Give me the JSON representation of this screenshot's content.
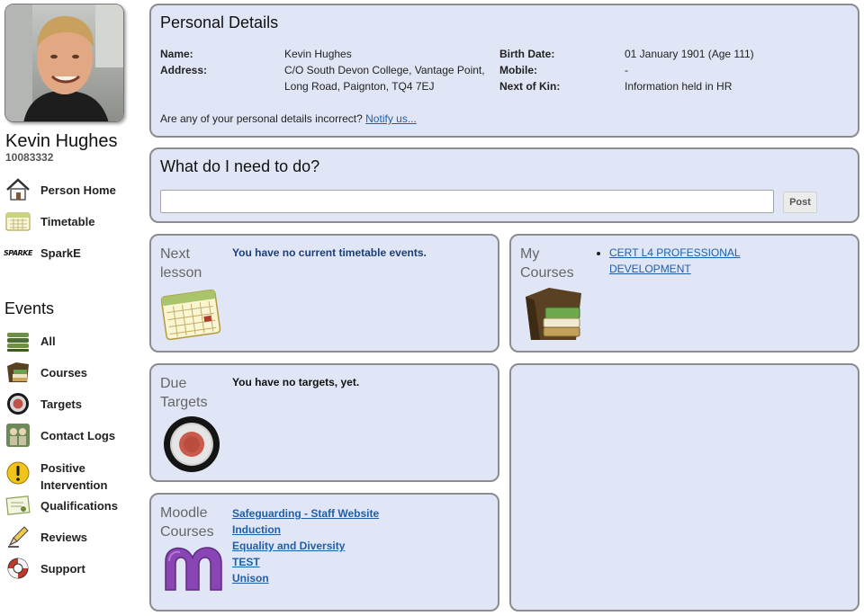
{
  "user": {
    "name": "Kevin Hughes",
    "id": "10083332"
  },
  "nav": {
    "items": [
      {
        "label": "Person Home",
        "icon": "house-icon"
      },
      {
        "label": "Timetable",
        "icon": "calendar-icon"
      },
      {
        "label": "SparkE",
        "icon": "sparke-logo-icon",
        "logo_text": "SPARKE"
      }
    ]
  },
  "events": {
    "heading": "Events",
    "items": [
      {
        "label": "All",
        "icon": "stack-icon"
      },
      {
        "label": "Courses",
        "icon": "folder-books-icon"
      },
      {
        "label": "Targets",
        "icon": "target-icon"
      },
      {
        "label": "Contact Logs",
        "icon": "people-icon"
      },
      {
        "label": "Positive Intervention",
        "icon": "exclamation-icon"
      },
      {
        "label": "Qualifications",
        "icon": "certificate-icon"
      },
      {
        "label": "Reviews",
        "icon": "pencil-icon"
      },
      {
        "label": "Support",
        "icon": "lifebuoy-icon"
      }
    ]
  },
  "personal": {
    "title": "Personal Details",
    "name_label": "Name:",
    "name_value": "Kevin Hughes",
    "address_label": "Address:",
    "address_line1": "C/O South Devon College, Vantage Point,",
    "address_line2": "Long Road, Paignton, TQ4 7EJ",
    "birth_label": "Birth Date:",
    "birth_value": "01 January 1901 (Age 111)",
    "mobile_label": "Mobile:",
    "mobile_value": "-",
    "kin_label": "Next of Kin:",
    "kin_value": "Information held in HR",
    "incorrect_text": "Are any of your personal details incorrect?",
    "notify_link": "Notify us..."
  },
  "todo": {
    "title": "What do I need to do?",
    "input_value": "",
    "post_label": "Post"
  },
  "next_lesson": {
    "title_line1": "Next",
    "title_line2": "lesson",
    "message": "You have no current timetable events."
  },
  "my_courses": {
    "title_line1": "My",
    "title_line2": "Courses",
    "items": [
      "CERT L4 PROFESSIONAL",
      "DEVELOPMENT"
    ]
  },
  "due_targets": {
    "title_line1": "Due",
    "title_line2": "Targets",
    "message": "You have no targets, yet."
  },
  "moodle": {
    "title_line1": "Moodle",
    "title_line2": "Courses",
    "links": [
      "Safeguarding - Staff Website",
      "Induction",
      "Equality and Diversity",
      "TEST",
      "Unison"
    ]
  },
  "colors": {
    "panel_bg": "#e1e6f6",
    "panel_border": "#8c8c8c",
    "link": "#1f5fa8",
    "message_blue": "#1a3f7a"
  }
}
